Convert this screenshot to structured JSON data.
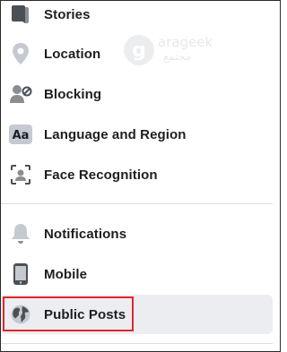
{
  "menu": {
    "items": [
      {
        "label": "Stories",
        "icon": "book-icon"
      },
      {
        "label": "Location",
        "icon": "location-pin-icon"
      },
      {
        "label": "Blocking",
        "icon": "user-block-icon"
      },
      {
        "label": "Language and Region",
        "icon": "language-aa-icon"
      },
      {
        "label": "Face Recognition",
        "icon": "face-recognition-icon"
      }
    ],
    "items2": [
      {
        "label": "Notifications",
        "icon": "bell-icon"
      },
      {
        "label": "Mobile",
        "icon": "mobile-phone-icon"
      },
      {
        "label": "Public Posts",
        "icon": "globe-icon",
        "selected": true
      }
    ]
  },
  "watermark": {
    "logo_letter": "g",
    "text": "arageek",
    "subtext": "مجتمع"
  },
  "colors": {
    "text": "#1c1e21",
    "icon_gray": "#8a8d91",
    "icon_dark": "#4b4f56",
    "selected_bg": "#ebedf0",
    "highlight": "#e4262b",
    "divider": "#dadde1"
  }
}
